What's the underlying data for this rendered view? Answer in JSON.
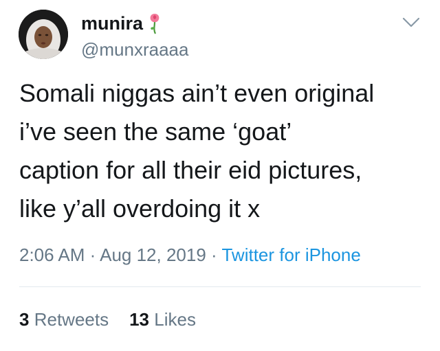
{
  "user": {
    "display_name": "munira",
    "handle": "@munxraaaa",
    "name_emoji": "rose-icon"
  },
  "tweet": {
    "lines": [
      "Somali niggas ain’t even original",
      "i’ve seen the same ‘goat’",
      "caption for all their eid pictures,",
      "like y’all overdoing it x"
    ]
  },
  "meta": {
    "time": "2:06 AM",
    "separator": "·",
    "date": "Aug 12, 2019",
    "source": "Twitter for iPhone"
  },
  "stats": {
    "retweets_count": "3",
    "retweets_label": "Retweets",
    "likes_count": "13",
    "likes_label": "Likes"
  },
  "colors": {
    "text": "#14171a",
    "secondary": "#657786",
    "link": "#1b95e0",
    "divider": "#e1e8ed"
  }
}
